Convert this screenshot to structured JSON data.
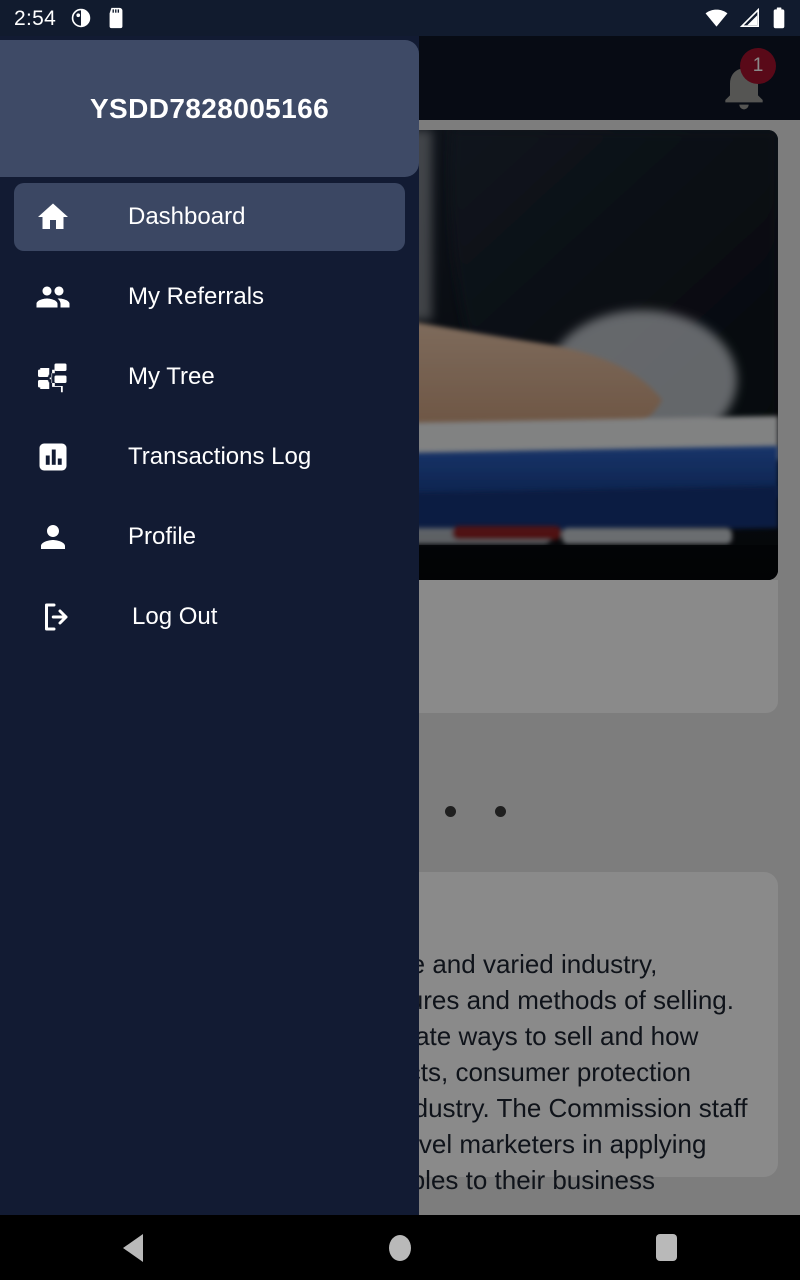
{
  "status_bar": {
    "time": "2:54",
    "left_icons": [
      "do-not-disturb-icon",
      "sd-card-icon"
    ],
    "right_icons": [
      "wifi-icon",
      "cellular-signal-icon",
      "battery-icon"
    ],
    "background": "#111b2e"
  },
  "app_bar": {
    "notification_count": "1",
    "bell_icon": "bell-icon",
    "badge_color": "#a4122e",
    "background": "#0d1626"
  },
  "drawer": {
    "header_title": "YSDD7828005166",
    "header_background": "#3e4a66",
    "background": "#121b33",
    "active_item_background": "#3b4763",
    "items": [
      {
        "label": "Dashboard",
        "icon": "home-icon",
        "active": true
      },
      {
        "label": "My Referrals",
        "icon": "people-icon",
        "active": false
      },
      {
        "label": "My Tree",
        "icon": "tree-icon",
        "active": false
      },
      {
        "label": "Transactions Log",
        "icon": "bar-chart-icon",
        "active": false
      },
      {
        "label": "Profile",
        "icon": "person-icon",
        "active": false
      },
      {
        "label": "Log Out",
        "icon": "logout-icon",
        "active": false
      }
    ]
  },
  "content": {
    "carousel": {
      "image_description": "person-in-suit-writing-with-pen-on-blue-folders",
      "dot_count": 4,
      "active_dot_index": 0
    },
    "info_card": {
      "body": "Multi-level marketing is a diverse and varied industry, employing many different structures and methods of selling. Although there are many legitimate ways to sell and how multi-level marketers sell products, consumer protection principles are universal to the industry. The Commission staff offers guidance to assist multi-level marketers in applying core consumer protection principles to their business practices."
    }
  },
  "nav_bar": {
    "buttons": [
      {
        "name": "back-button",
        "icon": "triangle-back-icon"
      },
      {
        "name": "home-button",
        "icon": "circle-home-icon"
      },
      {
        "name": "recents-button",
        "icon": "square-recents-icon"
      }
    ]
  }
}
